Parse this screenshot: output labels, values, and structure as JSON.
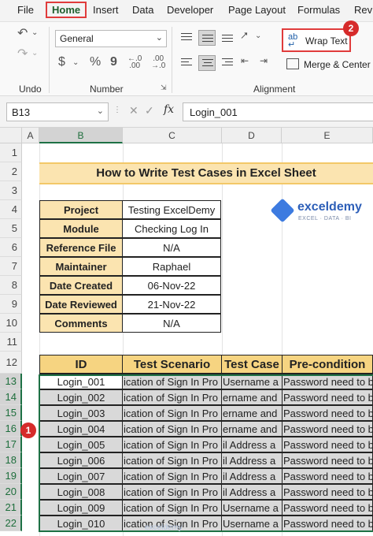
{
  "menu": {
    "items": [
      "File",
      "Home",
      "Insert",
      "Data",
      "Developer",
      "Page Layout",
      "Formulas",
      "Revie"
    ],
    "active": "Home"
  },
  "ribbon": {
    "font_name": "General",
    "undo_label": "Undo",
    "number_label": "Number",
    "alignment_label": "Alignment",
    "wrap_text_label": "Wrap Text",
    "merge_center_label": "Merge & Center",
    "number_symbols": [
      "$",
      "%",
      "9"
    ],
    "badge_2": "2"
  },
  "formula_bar": {
    "name_box": "B13",
    "fx_symbol": "fx",
    "formula": "Login_001"
  },
  "columns": [
    "A",
    "B",
    "C",
    "D",
    "E"
  ],
  "rows": [
    "1",
    "2",
    "3",
    "4",
    "5",
    "6",
    "7",
    "8",
    "9",
    "10",
    "11",
    "12",
    "13",
    "14",
    "15",
    "16",
    "17",
    "18",
    "19",
    "20",
    "21",
    "22"
  ],
  "sheet": {
    "title": "How to Write Test Cases in Excel Sheet",
    "info": [
      {
        "key": "Project",
        "value": "Testing ExcelDemy"
      },
      {
        "key": "Module",
        "value": "Checking Log In"
      },
      {
        "key": "Reference File",
        "value": "N/A"
      },
      {
        "key": "Maintainer",
        "value": "Raphael"
      },
      {
        "key": "Date Created",
        "value": "06-Nov-22"
      },
      {
        "key": "Date Reviewed",
        "value": "21-Nov-22"
      },
      {
        "key": "Comments",
        "value": "N/A"
      }
    ],
    "headers": [
      "ID",
      "Test Scenario",
      "Test Case",
      "Pre-condition"
    ],
    "rows": [
      {
        "id": "Login_001",
        "scenario": "ication of Sign In Pro",
        "case": " Username a",
        "pre": "Password need to b"
      },
      {
        "id": "Login_002",
        "scenario": "ication of Sign In Pro",
        "case": "ername and",
        "pre": "Password need to b"
      },
      {
        "id": "Login_003",
        "scenario": "ication of Sign In Pro",
        "case": "ername and",
        "pre": "Password need to b"
      },
      {
        "id": "Login_004",
        "scenario": "ication of Sign In Pro",
        "case": "ername and",
        "pre": "Password need to b"
      },
      {
        "id": "Login_005",
        "scenario": "ication of Sign In Pro",
        "case": "il Address a",
        "pre": "Password need to b"
      },
      {
        "id": "Login_006",
        "scenario": "ication of Sign In Pro",
        "case": "il Address a",
        "pre": "Password need to b"
      },
      {
        "id": "Login_007",
        "scenario": "ication of Sign In Pro",
        "case": "il Address a",
        "pre": "Password need to b"
      },
      {
        "id": "Login_008",
        "scenario": "ication of Sign In Pro",
        "case": "il Address a",
        "pre": "Password need to b"
      },
      {
        "id": "Login_009",
        "scenario": "ication of Sign In Pro",
        "case": " Username a",
        "pre": "Password need to b"
      },
      {
        "id": "Login_010",
        "scenario": "ication of Sign In Pro",
        "case": " Username a",
        "pre": "Password need to b"
      }
    ]
  },
  "logo": {
    "name": "exceldemy",
    "tagline": "EXCEL · DATA · BI"
  },
  "badge_1": "1",
  "watermark": "exceldemy"
}
